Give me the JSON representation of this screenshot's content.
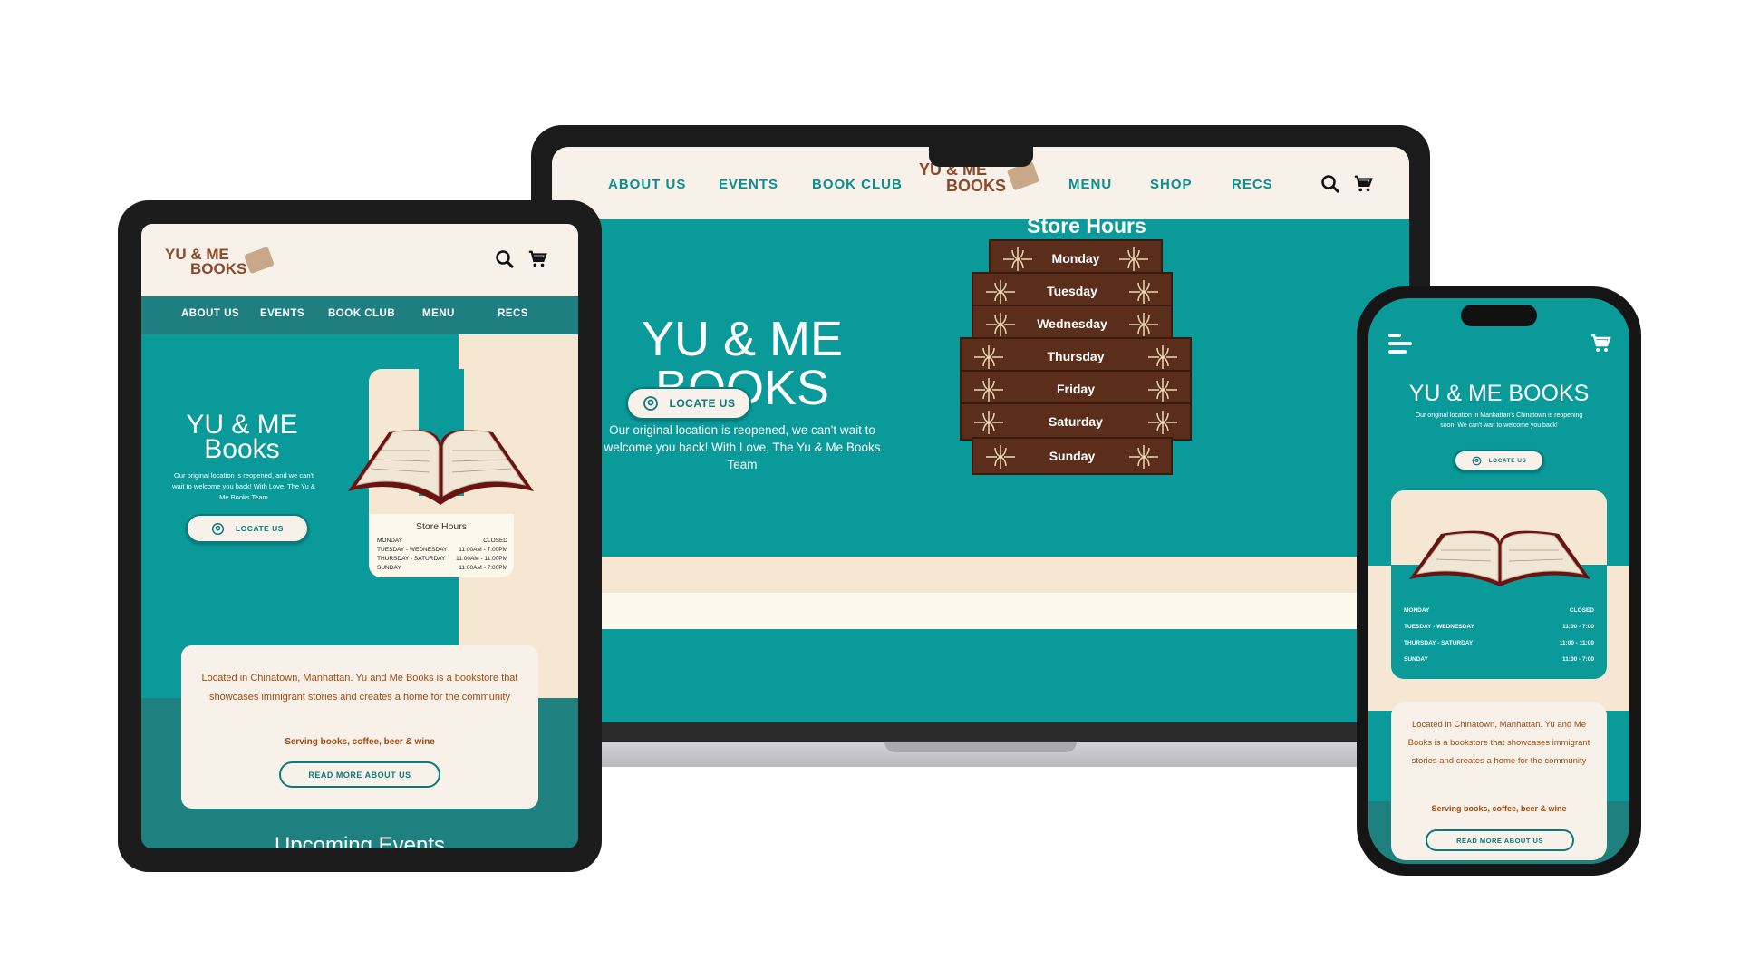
{
  "brand": {
    "line1": "YU & ME",
    "line2": "BOOKS",
    "tablet_line1": "YU & ME"
  },
  "laptop": {
    "nav": [
      "ABOUT US",
      "EVENTS",
      "BOOK CLUB",
      "MENU",
      "SHOP",
      "RECS"
    ],
    "hero_title_1": "YU & ME",
    "hero_title_2": "BOOKS",
    "hero_text": "Our original location is reopened, we can't wait to welcome you back! With Love, The Yu & Me Books Team",
    "locate_label": "LOCATE US",
    "hours_title": "Store Hours",
    "days": [
      "Monday",
      "Tuesday",
      "Wednesday",
      "Thursday",
      "Friday",
      "Saturday",
      "Sunday"
    ]
  },
  "tablet": {
    "nav": [
      "ABOUT US",
      "EVENTS",
      "BOOK CLUB",
      "MENU",
      "RECS"
    ],
    "hero_title_1": "YU & ME",
    "hero_title_2": "Books",
    "hero_text": "Our original location is reopened, and we can't wait to welcome you back! With Love, The Yu & Me Books Team",
    "locate_label": "LOCATE US",
    "hours_title": "Store Hours",
    "hours": [
      {
        "day": "MONDAY",
        "time": "CLOSED"
      },
      {
        "day": "TUESDAY - WEDNESDAY",
        "time": "11:00AM - 7:00PM"
      },
      {
        "day": "THURSDAY - SATURDAY",
        "time": "11:00AM - 11:00PM"
      },
      {
        "day": "SUNDAY",
        "time": "11:00AM - 7:00PM"
      }
    ],
    "about_text": "Located in Chinatown, Manhattan. Yu and Me Books is a bookstore that showcases immigrant stories and creates a home for the community",
    "serving": "Serving books, coffee, beer & wine",
    "read_more": "READ MORE ABOUT US",
    "upcoming": "Upcoming Events"
  },
  "phone": {
    "hero_title": "YU & ME BOOKS",
    "hero_text": "Our original location in Manhattan's Chinatown is reopening soon. We can't wait to welcome you back!",
    "locate_label": "LOCATE US",
    "hours": [
      {
        "day": "MONDAY",
        "time": "CLOSED"
      },
      {
        "day": "TUESDAY - WEDNESDAY",
        "time": "11:00 - 7:00"
      },
      {
        "day": "THURSDAY - SATURDAY",
        "time": "11:00 - 11:00"
      },
      {
        "day": "SUNDAY",
        "time": "11:00 - 7:00"
      }
    ],
    "about_text": "Located in Chinatown, Manhattan. Yu and Me Books is a bookstore that showcases immigrant stories and creates a home for the community",
    "serving": "Serving books, coffee, beer & wine",
    "read_more": "READ MORE ABOUT US"
  },
  "colors": {
    "teal": "#0a9a9a",
    "dark_teal": "#1f8080",
    "cream": "#f7f1ea",
    "peach": "#f6e7d2",
    "brown": "#5a2e1b",
    "logo_brown": "#8b4a2a"
  }
}
